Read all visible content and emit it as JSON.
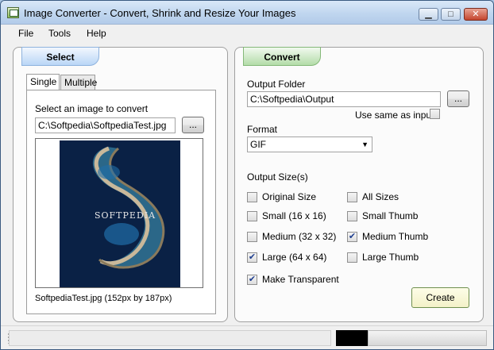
{
  "window": {
    "title": "Image Converter - Convert, Shrink and Resize Your Images",
    "minimize_glyph": "▁",
    "maximize_glyph": "□",
    "close_glyph": "✕"
  },
  "menu": {
    "items": [
      "File",
      "Tools",
      "Help"
    ]
  },
  "select_panel": {
    "tab_label": "Select",
    "subtabs": [
      "Single",
      "Multiple"
    ],
    "prompt": "Select an image to convert",
    "file_path": "C:\\Softpedia\\SoftpediaTest.jpg",
    "browse_label": "...",
    "preview_watermark": "SOFTPEDIA",
    "caption": "SoftpediaTest.jpg (152px by 187px)"
  },
  "convert_panel": {
    "tab_label": "Convert",
    "output_folder_label": "Output Folder",
    "output_folder_path": "C:\\Softpedia\\Output",
    "browse_label": "...",
    "use_same_label": "Use same as input",
    "use_same_checked": false,
    "format_label": "Format",
    "format_value": "GIF",
    "output_sizes_label": "Output Size(s)",
    "sizes_left": [
      {
        "label": "Original Size",
        "checked": false
      },
      {
        "label": "Small (16 x 16)",
        "checked": false
      },
      {
        "label": "Medium (32 x 32)",
        "checked": false
      },
      {
        "label": "Large (64 x 64)",
        "checked": true
      }
    ],
    "sizes_right": [
      {
        "label": "All Sizes",
        "checked": false
      },
      {
        "label": "Small Thumb",
        "checked": false
      },
      {
        "label": "Medium Thumb",
        "checked": true
      },
      {
        "label": "Large Thumb",
        "checked": false
      }
    ],
    "transparent_label": "Make Transparent",
    "transparent_checked": true,
    "create_label": "Create"
  },
  "colors": {
    "select_tab": "#b9d6f6",
    "convert_tab": "#b3dca8",
    "checkmark": "#1f3f8f"
  }
}
